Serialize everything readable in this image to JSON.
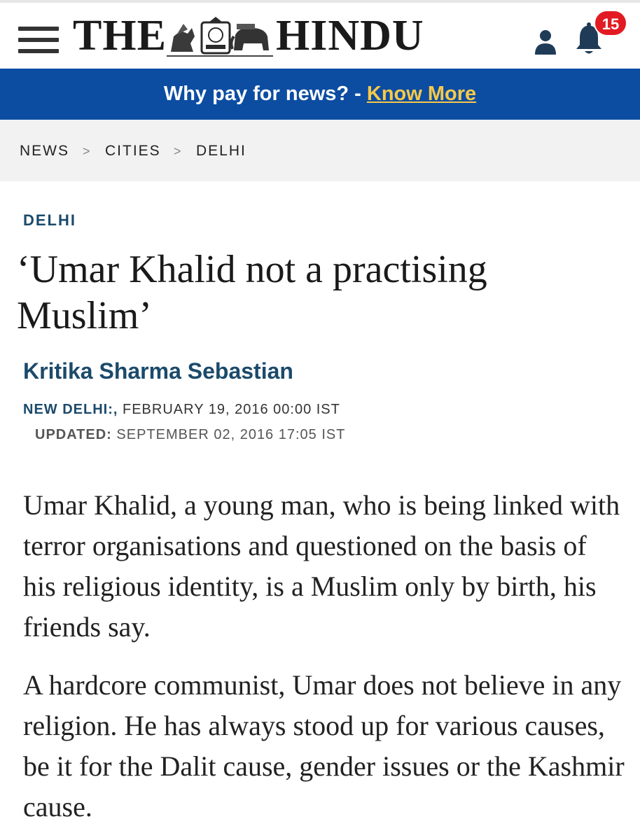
{
  "header": {
    "menu_icon": "hamburger-menu-icon",
    "masthead": {
      "left": "THE",
      "right": "HINDU"
    },
    "user_icon": "user-icon",
    "bell_icon": "bell-icon",
    "notification_count": "15"
  },
  "promo": {
    "text": "Why pay for news? - ",
    "link_label": "Know More",
    "link_color": "#f7c948",
    "background": "#0c4da2"
  },
  "breadcrumb": {
    "items": [
      "NEWS",
      "CITIES",
      "DELHI"
    ],
    "separator": ">"
  },
  "article": {
    "section": "DELHI",
    "headline": "‘Umar Khalid not a practising Muslim’",
    "author": "Kritika Sharma Sebastian",
    "dateline_place": "NEW DELHI:,",
    "dateline_date": " FEBRUARY 19, 2016 00:00 IST",
    "updated_label": "UPDATED:",
    "updated_date": " SEPTEMBER 02, 2016 17:05 IST",
    "paragraphs": [
      "Umar Khalid, a young man, who is being linked with terror organisations and questioned on the basis of his religious identity, is a Muslim only by birth, his friends say.",
      "A hardcore communist, Umar does not believe in any religion. He has always stood up for various causes, be it for the Dalit cause, gender issues or the Kashmir cause."
    ]
  },
  "colors": {
    "accent_blue": "#1b4a6b",
    "badge_red": "#e21b23"
  }
}
